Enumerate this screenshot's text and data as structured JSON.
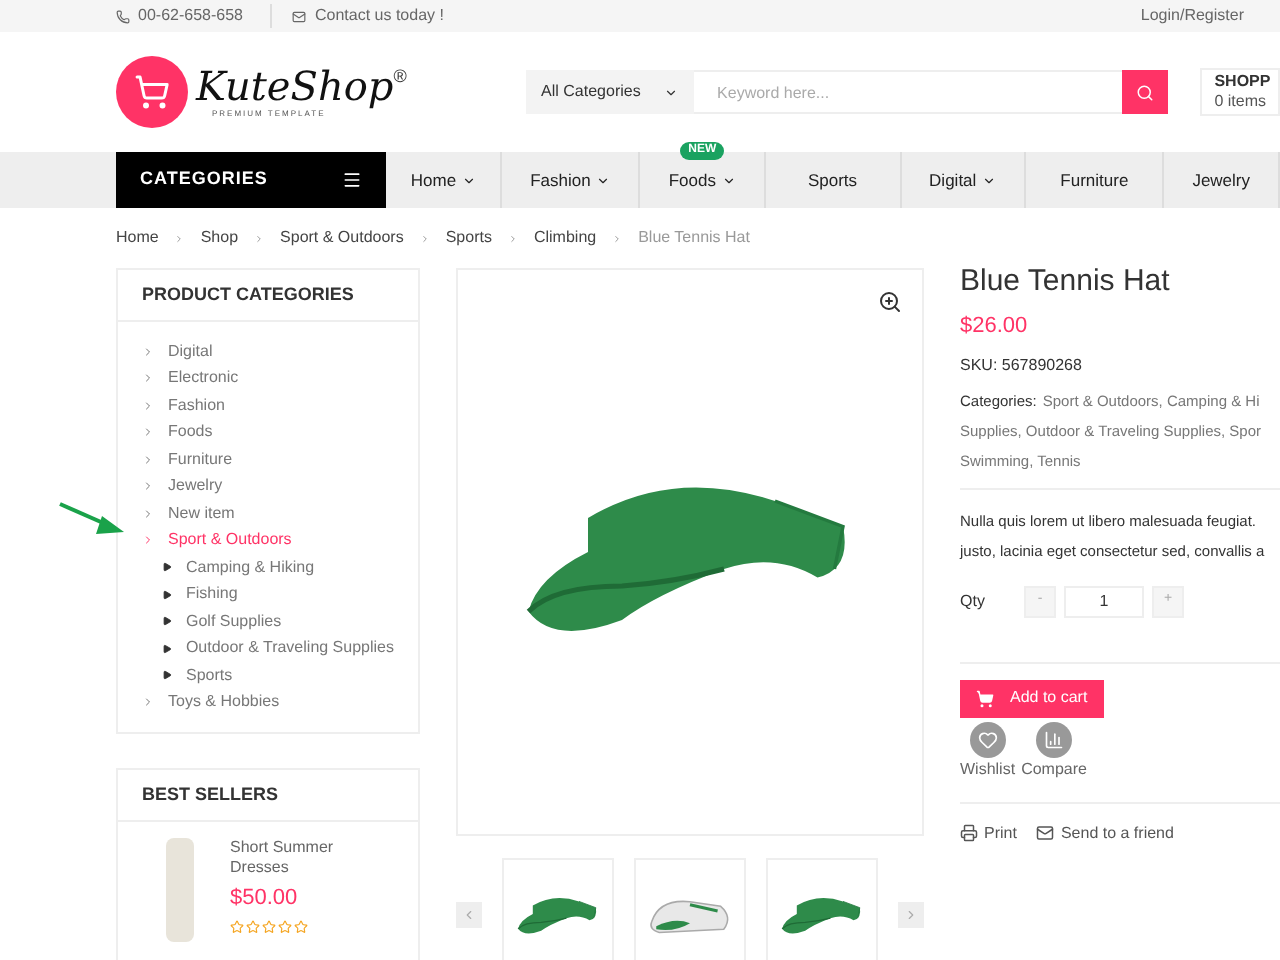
{
  "top_bar": {
    "phone": "00-62-658-658",
    "contact": "Contact us today !",
    "login": "Login/Register"
  },
  "header": {
    "logo_text": "KuteShop",
    "logo_sub": "PREMIUM TEMPLATE",
    "logo_mark": "®",
    "category_select": "All Categories",
    "search_placeholder": "Keyword here...",
    "cart_title": "SHOPP",
    "cart_count": "0 items"
  },
  "nav": {
    "categories_label": "CATEGORIES",
    "items": [
      {
        "label": "Home",
        "dropdown": true
      },
      {
        "label": "Fashion",
        "dropdown": true
      },
      {
        "label": "Foods",
        "dropdown": true,
        "badge": "NEW"
      },
      {
        "label": "Sports",
        "dropdown": false
      },
      {
        "label": "Digital",
        "dropdown": true
      },
      {
        "label": "Furniture",
        "dropdown": false
      },
      {
        "label": "Jewelry",
        "dropdown": false
      }
    ]
  },
  "breadcrumb": [
    "Home",
    "Shop",
    "Sport & Outdoors",
    "Sports",
    "Climbing",
    "Blue Tennis Hat"
  ],
  "product_categories": {
    "title": "PRODUCT CATEGORIES",
    "items": [
      {
        "label": "Digital",
        "selected": false
      },
      {
        "label": "Electronic",
        "selected": false
      },
      {
        "label": "Fashion",
        "selected": false
      },
      {
        "label": "Foods",
        "selected": false
      },
      {
        "label": "Furniture",
        "selected": false
      },
      {
        "label": "Jewelry",
        "selected": false
      },
      {
        "label": "New item",
        "selected": false
      },
      {
        "label": "Sport & Outdoors",
        "selected": true,
        "children": [
          {
            "label": "Camping & Hiking",
            "selected": false
          },
          {
            "label": "Fishing",
            "selected": false
          },
          {
            "label": "Golf Supplies",
            "selected": false
          },
          {
            "label": "Outdoor & Traveling Supplies",
            "selected": false
          },
          {
            "label": "Sports",
            "selected": false
          }
        ]
      },
      {
        "label": "Toys & Hobbies",
        "selected": false
      }
    ]
  },
  "best_sellers": {
    "title": "BEST SELLERS",
    "items": [
      {
        "name": "Short Summer Dresses",
        "price": "$50.00",
        "stars": 0
      }
    ]
  },
  "gallery": {
    "thumbnails": [
      {
        "kind": "hat"
      },
      {
        "kind": "shoe"
      },
      {
        "kind": "hat"
      }
    ]
  },
  "product": {
    "title": "Blue Tennis Hat",
    "price": "$26.00",
    "sku": "SKU: 567890268",
    "categories_label": "Categories:",
    "categories_lines": [
      "Sport & Outdoors, Camping & Hi",
      "Supplies, Outdoor & Traveling Supplies, Spor",
      "Swimming, Tennis"
    ],
    "description_lines": [
      "Nulla quis lorem ut libero malesuada feugiat.",
      "justo, lacinia eget consectetur sed, convallis a"
    ],
    "qty_label": "Qty",
    "qty_minus": "-",
    "qty_value": "1",
    "qty_plus": "+",
    "add_to_cart": "Add to cart",
    "wishlist": "Wishlist",
    "compare": "Compare",
    "print": "Print",
    "send": "Send to a friend"
  }
}
